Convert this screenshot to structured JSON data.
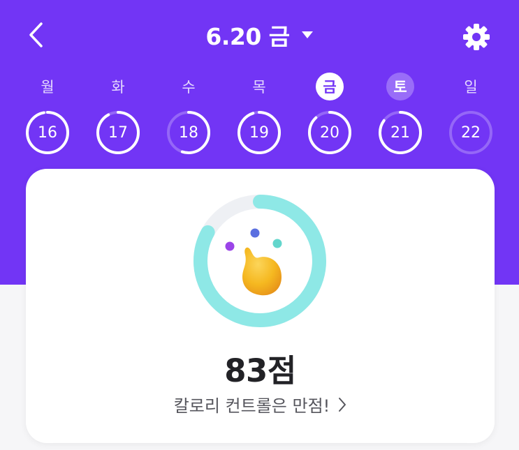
{
  "header": {
    "date_title": "6.20 금"
  },
  "week": [
    {
      "day": "월",
      "date": "16",
      "progress": 0.97,
      "state": "normal"
    },
    {
      "day": "화",
      "date": "17",
      "progress": 0.92,
      "state": "normal"
    },
    {
      "day": "수",
      "date": "18",
      "progress": 0.55,
      "state": "normal"
    },
    {
      "day": "목",
      "date": "19",
      "progress": 0.95,
      "state": "normal"
    },
    {
      "day": "금",
      "date": "20",
      "progress": 0.88,
      "state": "selected"
    },
    {
      "day": "토",
      "date": "21",
      "progress": 0.85,
      "state": "today"
    },
    {
      "day": "일",
      "date": "22",
      "progress": 0.0,
      "state": "normal"
    }
  ],
  "score": {
    "value_text": "83점",
    "percent": 0.83,
    "message": "칼로리 컨트롤은 만점!"
  },
  "colors": {
    "primary": "#7235f5",
    "ring_progress": "#8ee8e6",
    "ring_track": "#eef0f4",
    "mascot": "#f5b820",
    "dot_purple": "#9b44e8",
    "dot_blue": "#5a6fe0",
    "dot_teal": "#63d6cc"
  }
}
